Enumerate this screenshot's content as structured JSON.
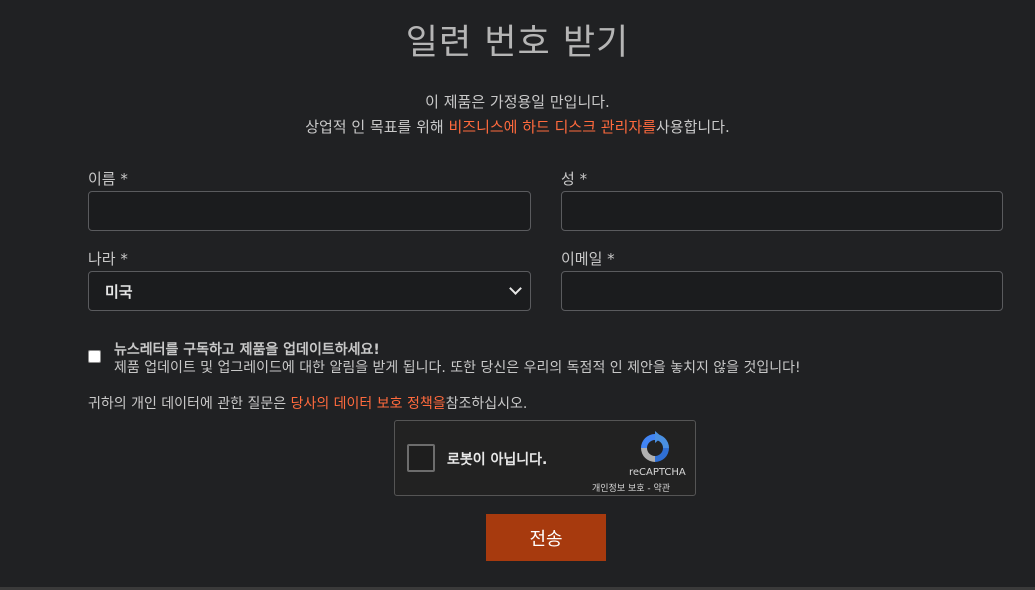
{
  "title": "일련 번호 받기",
  "intro": {
    "line1": "이 제품은 가정용일 만입니다.",
    "line2_prefix": "상업적 인 목표를 위해 ",
    "line2_link": "비즈니스에 하드 디스크 관리자를",
    "line2_suffix": "사용합니다."
  },
  "fields": {
    "first_name_label": "이름 *",
    "last_name_label": "성 *",
    "country_label": "나라 *",
    "country_value": "미국",
    "email_label": "이메일 *"
  },
  "newsletter": {
    "title": "뉴스레터를 구독하고 제품을 업데이트하세요!",
    "description": "제품 업데이트 및 업그레이드에 대한 알림을 받게 됩니다. 또한 당신은 우리의 독점적 인 제안을 놓치지 않을 것입니다!"
  },
  "privacy": {
    "prefix": "귀하의 개인 데이터에 관한 질문은 ",
    "link": "당사의 데이터 보호 정책을",
    "suffix": "참조하십시오."
  },
  "recaptcha": {
    "label": "로봇이 아닙니다.",
    "brand": "reCAPTCHA",
    "terms": "개인정보 보호 - 약관"
  },
  "submit_label": "전송",
  "colors": {
    "accent": "#ff6a3d",
    "submit": "#a73a0e",
    "background": "#202123"
  }
}
